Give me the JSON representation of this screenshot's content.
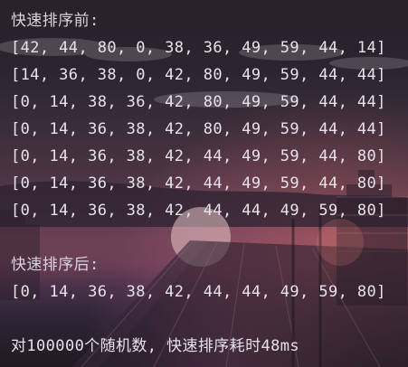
{
  "console": {
    "before_heading": "快速排序前:",
    "steps": [
      "[42, 44, 80, 0, 38, 36, 49, 59, 44, 14]",
      "[14, 36, 38, 0, 42, 80, 49, 59, 44, 44]",
      "[0, 14, 38, 36, 42, 80, 49, 59, 44, 44]",
      "[0, 14, 36, 38, 42, 80, 49, 59, 44, 44]",
      "[0, 14, 36, 38, 42, 44, 49, 59, 44, 80]",
      "[0, 14, 36, 38, 42, 44, 49, 59, 44, 80]",
      "[0, 14, 36, 38, 42, 44, 44, 49, 59, 80]"
    ],
    "after_heading": "快速排序后:",
    "result": "[0, 14, 36, 38, 42, 44, 44, 49, 59, 80]",
    "summary": "对100000个随机数, 快速排序耗时48ms"
  }
}
